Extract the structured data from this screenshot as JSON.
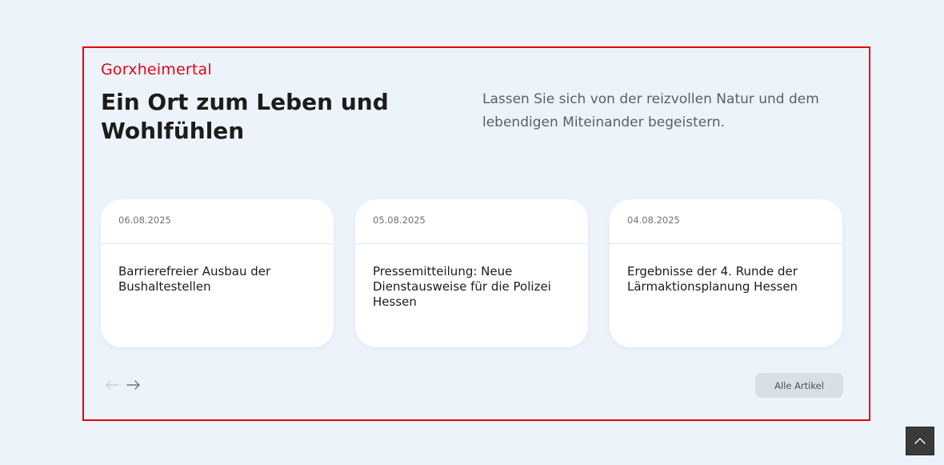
{
  "section": {
    "kicker": "Gorxheimertal",
    "title": "Ein Ort zum Leben und Wohlfühlen",
    "intro": "Lassen Sie sich von der reizvollen Natur und dem lebendigen Miteinander begeistern."
  },
  "articles": [
    {
      "date": "06.08.2025",
      "headline": "Barrierefreier Ausbau der Bushaltestellen"
    },
    {
      "date": "05.08.2025",
      "headline": "Pressemitteilung: Neue Dienstausweise für die Polizei Hessen"
    },
    {
      "date": "04.08.2025",
      "headline": "Ergebnisse der 4. Runde der Lärmaktionsplanung Hessen"
    }
  ],
  "controls": {
    "prev_icon": "arrow-left-icon",
    "next_icon": "arrow-right-icon",
    "all_articles_label": "Alle Artikel",
    "scroll_top_icon": "chevron-up-icon"
  },
  "colors": {
    "accent": "#e30613",
    "background": "#edf3fa",
    "card": "#ffffff",
    "button_bg": "#d8dfe5",
    "scroll_top_bg": "#3a3a3a"
  }
}
